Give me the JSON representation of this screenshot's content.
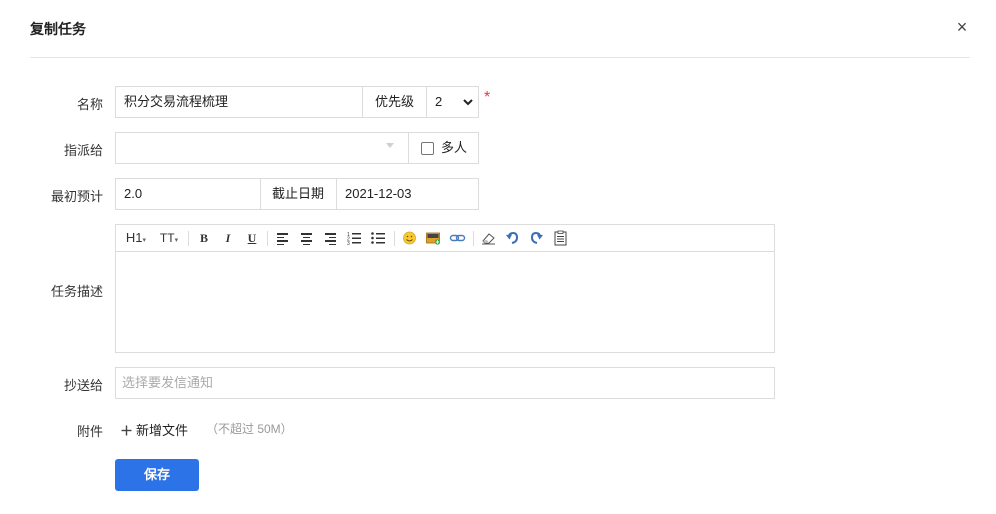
{
  "dialog": {
    "title": "复制任务",
    "close_glyph": "×"
  },
  "form": {
    "name": {
      "label": "名称",
      "value": "积分交易流程梳理"
    },
    "priority": {
      "label": "优先级",
      "value": "2",
      "required_mark": "*"
    },
    "assignee": {
      "label": "指派给",
      "value": "",
      "multi_label": "多人",
      "multi_checked": false
    },
    "estimate": {
      "label": "最初预计",
      "value": "2.0"
    },
    "deadline": {
      "label": "截止日期",
      "value": "2021-12-03"
    },
    "description": {
      "label": "任务描述",
      "toolbar": {
        "heading": "H1",
        "font_size": "TT",
        "bold": "B",
        "italic": "I",
        "underline": "U"
      }
    },
    "cc": {
      "label": "抄送给",
      "placeholder": "选择要发信通知"
    },
    "attachment": {
      "label": "附件",
      "add_label": "新增文件",
      "limit": "（不超过 50M）"
    }
  },
  "actions": {
    "save_label": "保存"
  },
  "colors": {
    "primary": "#2c73e8",
    "required": "#e8364f"
  }
}
